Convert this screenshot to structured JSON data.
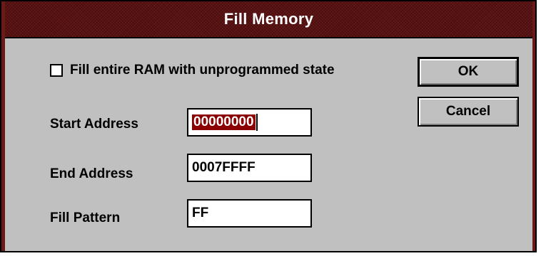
{
  "window": {
    "title": "Fill Memory"
  },
  "options": {
    "fill_entire_label": "Fill entire RAM with unprogrammed state",
    "fill_entire_checked": false
  },
  "fields": {
    "start_address": {
      "label": "Start Address",
      "value": "00000000"
    },
    "end_address": {
      "label": "End Address",
      "value": "0007FFFF"
    },
    "fill_pattern": {
      "label": "Fill Pattern",
      "value": "FF"
    }
  },
  "buttons": {
    "ok_label": "OK",
    "cancel_label": "Cancel"
  },
  "colors": {
    "titlebar": "#5a1010",
    "dialog_face": "#c0c0c0",
    "selection": "#8b0000"
  }
}
